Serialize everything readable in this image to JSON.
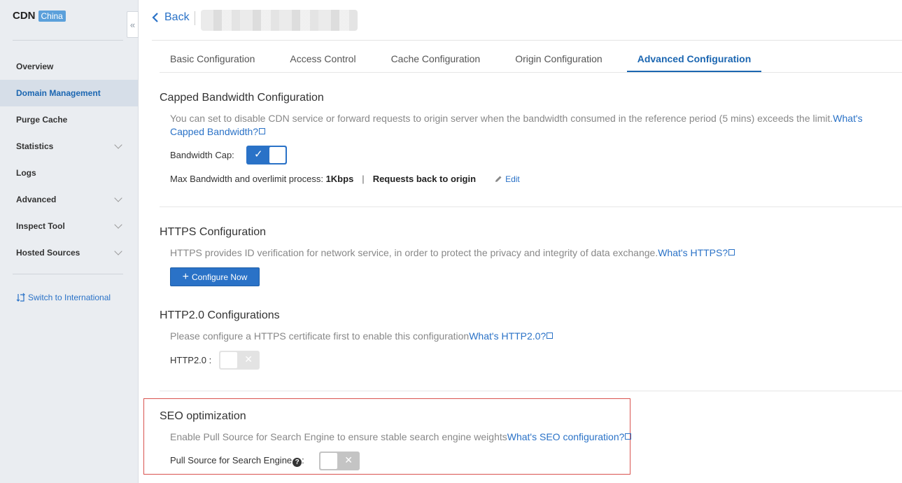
{
  "sidebar": {
    "brand_title": "CDN",
    "brand_badge": "China",
    "collapse_glyph": "«",
    "items": [
      {
        "label": "Overview",
        "active": false,
        "expandable": false
      },
      {
        "label": "Domain Management",
        "active": true,
        "expandable": false
      },
      {
        "label": "Purge Cache",
        "active": false,
        "expandable": false
      },
      {
        "label": "Statistics",
        "active": false,
        "expandable": true
      },
      {
        "label": "Logs",
        "active": false,
        "expandable": false
      },
      {
        "label": "Advanced",
        "active": false,
        "expandable": true
      },
      {
        "label": "Inspect Tool",
        "active": false,
        "expandable": true
      },
      {
        "label": "Hosted Sources",
        "active": false,
        "expandable": true
      }
    ],
    "switch_label": "Switch to International"
  },
  "header": {
    "back_label": "Back"
  },
  "tabs": [
    {
      "label": "Basic Configuration",
      "active": false
    },
    {
      "label": "Access Control",
      "active": false
    },
    {
      "label": "Cache Configuration",
      "active": false
    },
    {
      "label": "Origin Configuration",
      "active": false
    },
    {
      "label": "Advanced Configuration",
      "active": true
    }
  ],
  "bandwidth": {
    "title": "Capped Bandwidth Configuration",
    "desc": "You can set to disable CDN service or forward requests to origin server when the bandwidth consumed in the reference period (5 mins) exceeds the limit.",
    "link": "What's Capped Bandwidth?",
    "cap_label": "Bandwidth Cap:",
    "cap_enabled": true,
    "max_label": "Max Bandwidth and overlimit process:",
    "max_value": "1Kbps",
    "separator": "|",
    "process": "Requests back to origin",
    "edit_label": "Edit"
  },
  "https": {
    "title": "HTTPS Configuration",
    "desc": "HTTPS provides ID verification for network service, in order to protect the privacy and integrity of data exchange.",
    "link": "What's HTTPS?",
    "button_label": "Configure Now"
  },
  "http2": {
    "title": "HTTP2.0 Configurations",
    "desc": "Please configure a HTTPS certificate first to enable this configuration",
    "link": "What's HTTP2.0?",
    "label": "HTTP2.0 :",
    "enabled": false
  },
  "seo": {
    "title": "SEO optimization",
    "desc": "Enable Pull Source for Search Engine to ensure stable search engine weights",
    "link": "What's SEO configuration?",
    "label": "Pull Source for Search Engine",
    "colon": ":",
    "enabled": false
  },
  "colors": {
    "accent": "#2a72c7",
    "sidebar_bg": "#eaedf1",
    "highlight_border": "#d9534f"
  }
}
